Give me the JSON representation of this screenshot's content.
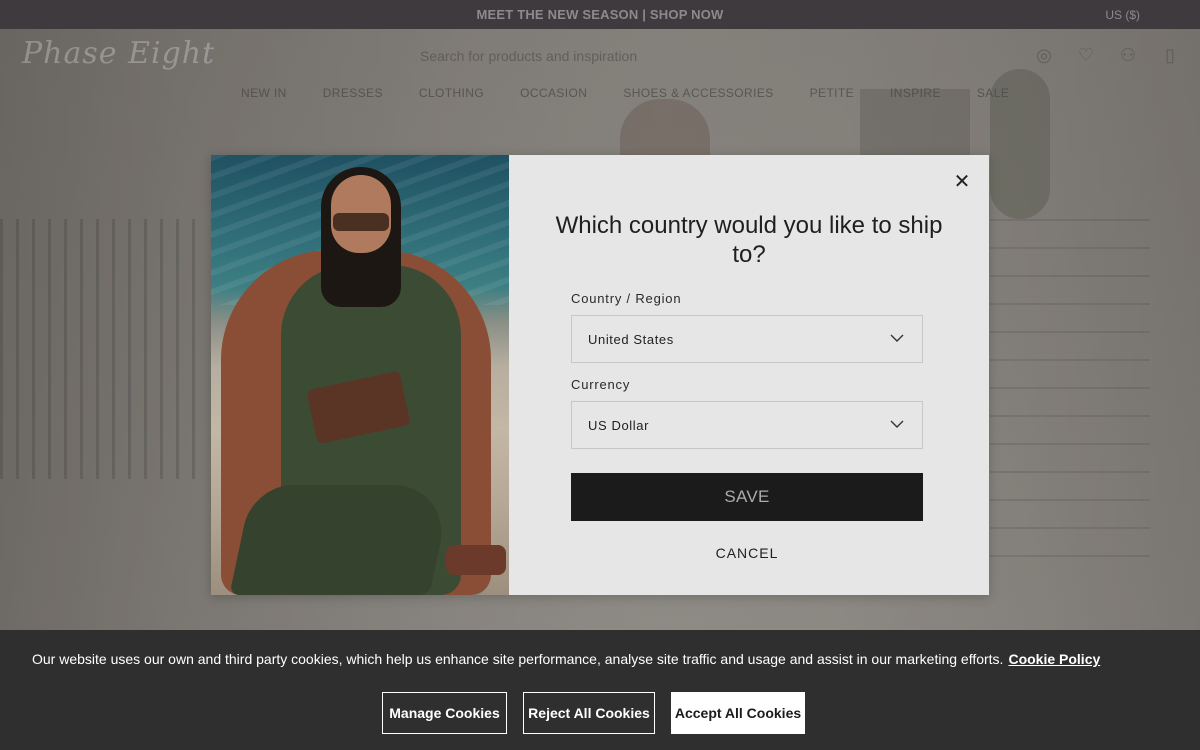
{
  "announcement": {
    "text": "MEET THE NEW SEASON | SHOP NOW",
    "currency": "US ($)"
  },
  "header": {
    "logo": "Phase Eight",
    "search_placeholder": "Search for products and inspiration",
    "icons": [
      "location-icon",
      "heart-icon",
      "account-icon",
      "bag-icon"
    ]
  },
  "nav": {
    "items": [
      "NEW IN",
      "DRESSES",
      "CLOTHING",
      "OCCASION",
      "SHOES & ACCESSORIES",
      "PETITE",
      "INSPIRE",
      "SALE"
    ]
  },
  "modal": {
    "title": "Which country would you like to ship to?",
    "country_label": "Country / Region",
    "country_value": "United States",
    "currency_label": "Currency",
    "currency_value": "US Dollar",
    "save_label": "SAVE",
    "cancel_label": "CANCEL"
  },
  "cookie": {
    "text": "Our website uses our own and third party cookies, which help us enhance site performance, analyse site traffic and usage and assist in our marketing efforts.",
    "link": "Cookie Policy",
    "manage_label": "Manage Cookies",
    "reject_label": "Reject All Cookies",
    "accept_label": "Accept All Cookies"
  },
  "colors": {
    "cookie_bg": "#2f2f2f",
    "save_bg": "#1b1b1b",
    "modal_bg": "#e7e6e6",
    "announce_bg": "#3e3a3d"
  }
}
